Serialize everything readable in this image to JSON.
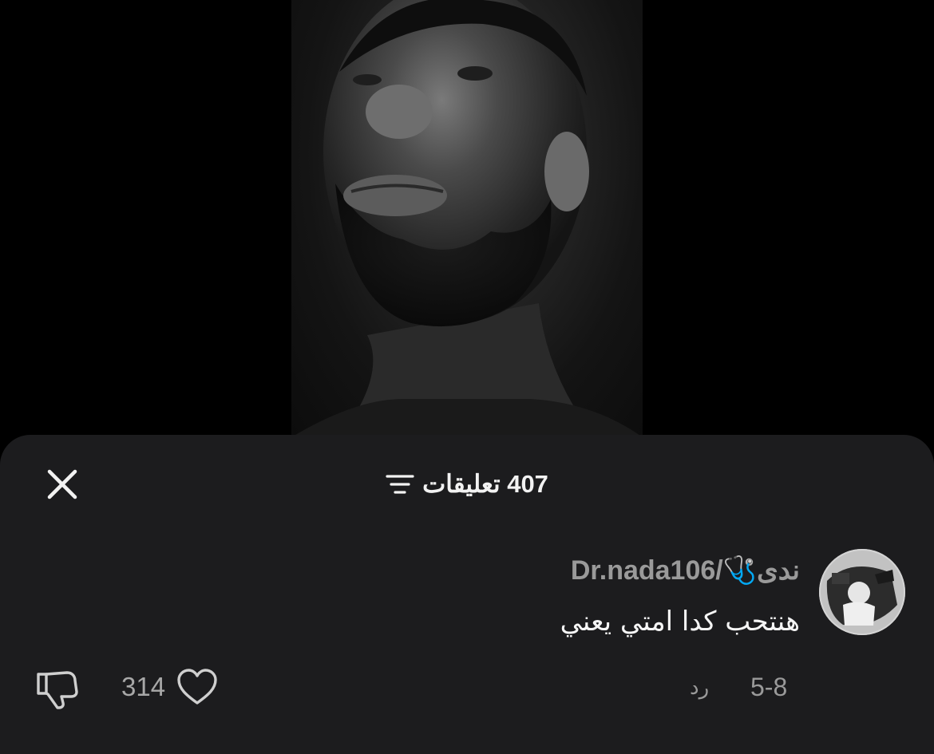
{
  "header": {
    "comment_count": "407",
    "comments_label": "تعليقات",
    "close_icon": "close-icon",
    "filter_icon": "filter-icon"
  },
  "comment": {
    "username": "ندى🩺/Dr.nada106",
    "text": "هنتحب كدا امتي يعني",
    "date": "5-8",
    "reply_label": "رد",
    "like_count": "314",
    "like_icon": "heart-icon",
    "dislike_icon": "dislike-icon"
  },
  "colors": {
    "sheet_background": "#1c1c1e",
    "primary_text": "#f5f5f5",
    "secondary_text": "#9a9a9a"
  }
}
